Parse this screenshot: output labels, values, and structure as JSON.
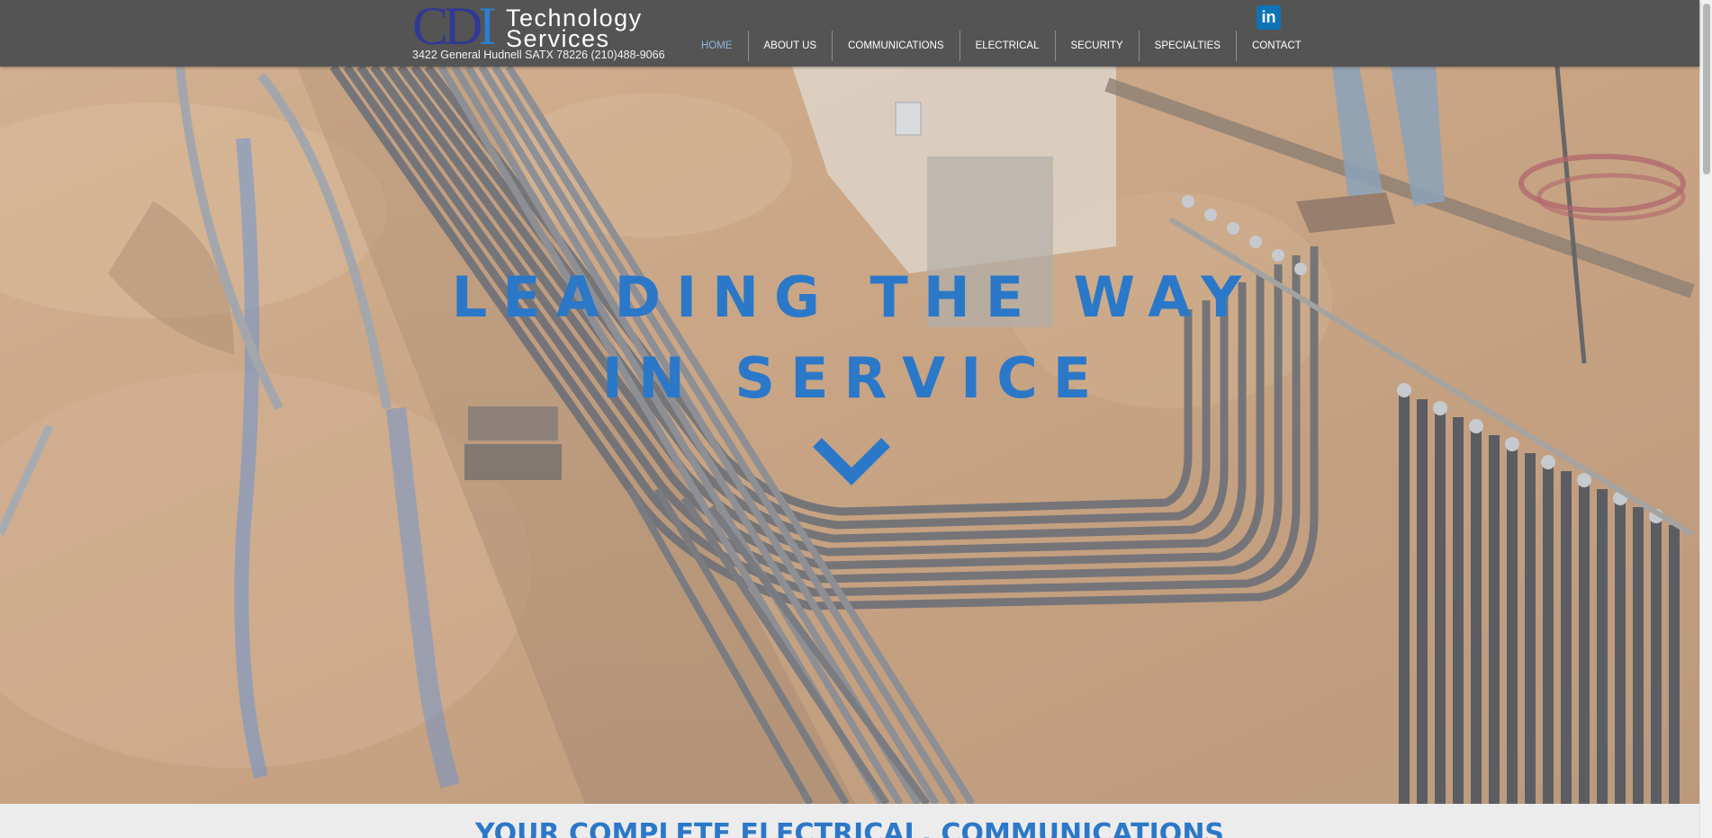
{
  "header": {
    "logo": {
      "cdi_text": "CDI",
      "line1": "Technology",
      "line2": "Services"
    },
    "address": "3422 General Hudnell SATX 78226  (210)488-9066",
    "nav": [
      {
        "label": "HOME",
        "active": true
      },
      {
        "label": "ABOUT US",
        "active": false
      },
      {
        "label": "COMMUNICATIONS",
        "active": false
      },
      {
        "label": "ELECTRICAL",
        "active": false
      },
      {
        "label": "SECURITY",
        "active": false
      },
      {
        "label": "SPECIALTIES",
        "active": false
      },
      {
        "label": "CONTACT",
        "active": false
      }
    ],
    "social": {
      "icon": "linkedin-icon",
      "text": "in"
    }
  },
  "hero": {
    "headline_line1": "LEADING THE WAY",
    "headline_line2": "IN SERVICE",
    "scroll_icon": "chevron-down-icon"
  },
  "section": {
    "title": "YOUR COMPLETE ELECTRICAL, COMMUNICATIONS"
  },
  "colors": {
    "header_bg": "#545454",
    "brand_blue": "#2c78c8",
    "nav_active": "#8fb6e2",
    "linkedin_blue": "#0d75b6",
    "band_bg": "#ececec"
  }
}
